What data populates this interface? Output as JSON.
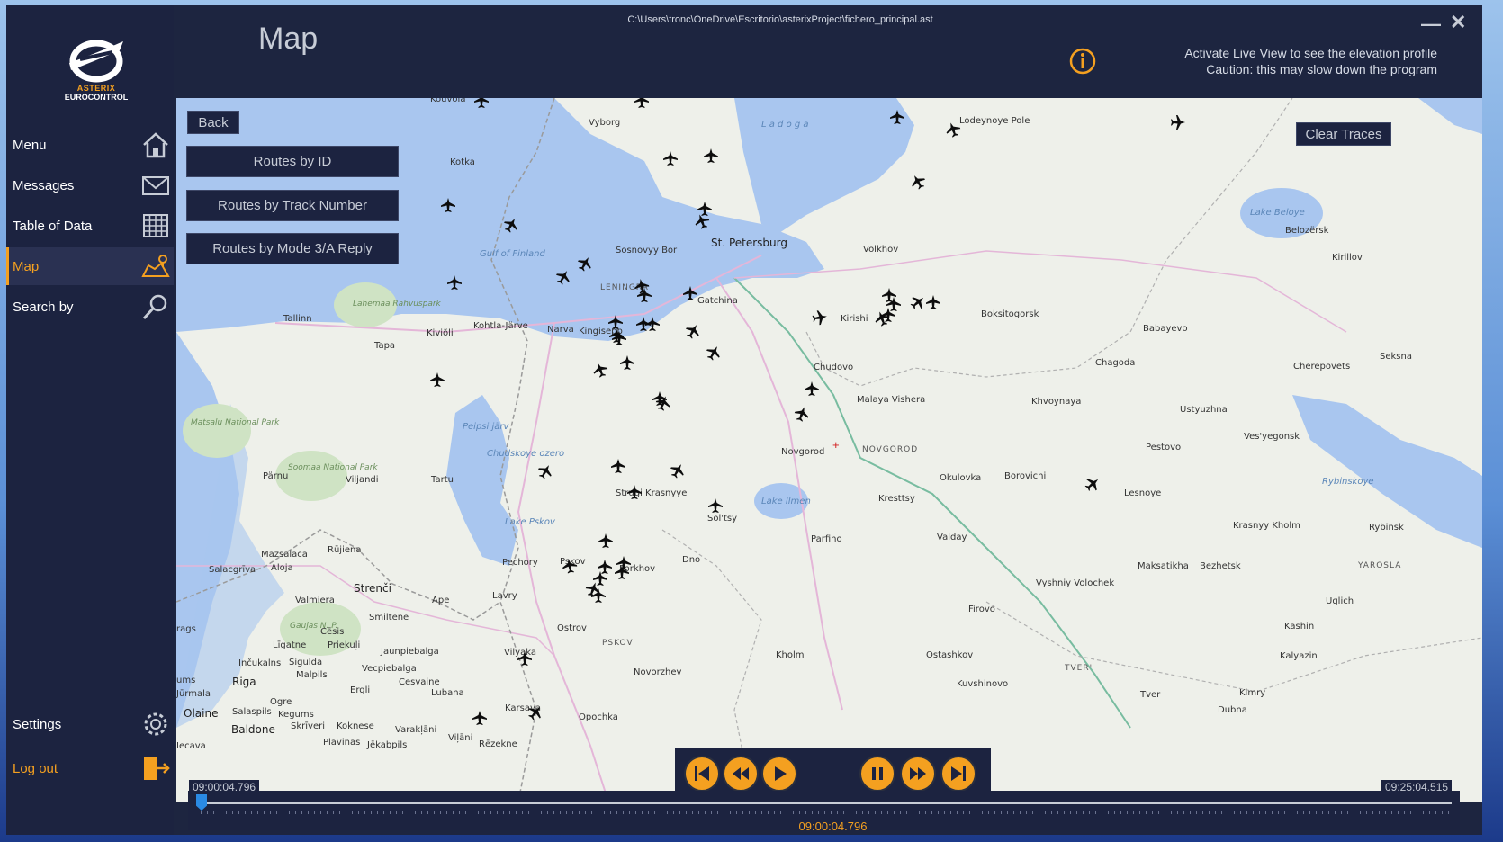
{
  "window": {
    "file_path": "C:\\Users\\tronc\\OneDrive\\Escritorio\\asterixProject\\fichero_principal.ast",
    "minimize": "—",
    "close": "✕"
  },
  "logo": {
    "line1": "ASTERIX",
    "line2": "EUROCONTROL"
  },
  "sidebar": {
    "items": [
      {
        "label": "Menu",
        "icon": "home-icon"
      },
      {
        "label": "Messages",
        "icon": "envelope-icon"
      },
      {
        "label": "Table of Data",
        "icon": "table-icon"
      },
      {
        "label": "Map",
        "icon": "map-icon",
        "active": true
      },
      {
        "label": "Search by",
        "icon": "search-icon"
      }
    ],
    "settings": "Settings",
    "logout": "Log out"
  },
  "header": {
    "title": "Map",
    "live_line1": "Activate Live View to see the elevation profile",
    "live_line2": "Caution: this may slow down the program"
  },
  "map": {
    "back": "Back",
    "routes_by_id": "Routes by ID",
    "routes_by_track": "Routes by Track Number",
    "routes_by_mode": "Routes by Mode 3/A Reply",
    "clear_traces": "Clear Traces",
    "places": [
      "Kouvola",
      "Vyborg",
      "Lodeynoye Pole",
      "Kotka",
      "L a d o g a",
      "St. Petersburg",
      "Sosnovyy Bor",
      "Gulf of Finland",
      "Volkhov",
      "Lake Beloye",
      "Belozërsk",
      "Kirillov",
      "LENINGRA",
      "Gatchina",
      "Tallinn",
      "Lahemaa Rahvuspark",
      "Kohtla-Järve",
      "Narva",
      "Kingisepp",
      "Kiviõli",
      "Tapa",
      "Kirishi",
      "Boksitogorsk",
      "Babayevo",
      "Chudovo",
      "Chagoda",
      "Cherepovets",
      "Seksna",
      "Malaya Vishera",
      "Khvoynaya",
      "Ustyuzhna",
      "Matsalu National Park",
      "Peipsi järv",
      "Chudskoye ozero",
      "Novgorod",
      "NOVGOROD",
      "Pestovo",
      "Ves'yegonsk",
      "Soomaa National Park",
      "Pärnu",
      "Viljandi",
      "Tartu",
      "Okulovka",
      "Borovichi",
      "Lesnoye",
      "Rybinskoye",
      "Strugi Krasnyye",
      "Lake Ilmen",
      "Kresttsy",
      "Krasnyy Kholm",
      "Rybinsk",
      "Lake Pskov",
      "Sol'tsy",
      "Valday",
      "Parfino",
      "Mazsalaca",
      "Rūjiena",
      "Salacgrīva",
      "Aloja",
      "Pechory",
      "Pskov",
      "Porkhov",
      "Dno",
      "Maksatikha",
      "Bezhetsk",
      "YAROSLA",
      "Strenči",
      "Lavry",
      "Vyshniy Volochek",
      "Uglich",
      "Valmiera",
      "Ape",
      "Firovo",
      "Smiltene",
      "Gaujas N. P.",
      "Cēsis",
      "Ostrov",
      "Kashin",
      "Līgatne",
      "Priekuļi",
      "Jaunpiebalga",
      "PSKOV",
      "Kholm",
      "Ostashkov",
      "Kalyazin",
      "Inčukalns",
      "Sigulda",
      "Vecpiebalga",
      "Vilyaka",
      "Malpils",
      "Cesvaine",
      "Novorzhev",
      "TVER'",
      "Riga",
      "Lubana",
      "Kuvshinovo",
      "Jūrmala",
      "Ergli",
      "Ogre",
      "Kimry",
      "Olaine",
      "Salaspils",
      "Kegums",
      "Karsava",
      "Opochka",
      "Tver",
      "Dubna",
      "Baldone",
      "Skrīveri",
      "Koknese",
      "Varakļāni",
      "Viļāni",
      "Jēkabpils",
      "Plavinas",
      "Rēzekne",
      "Iecava",
      "rags",
      "ums"
    ]
  },
  "playback": {
    "start_time": "09:00:04.796",
    "end_time": "09:25:04.515",
    "current_time": "09:00:04.796",
    "progress": 0.0
  },
  "colors": {
    "accent": "#f4a020",
    "sidebar": "#1c2340",
    "water": "#a9c6ef",
    "land": "#eef0ea"
  }
}
